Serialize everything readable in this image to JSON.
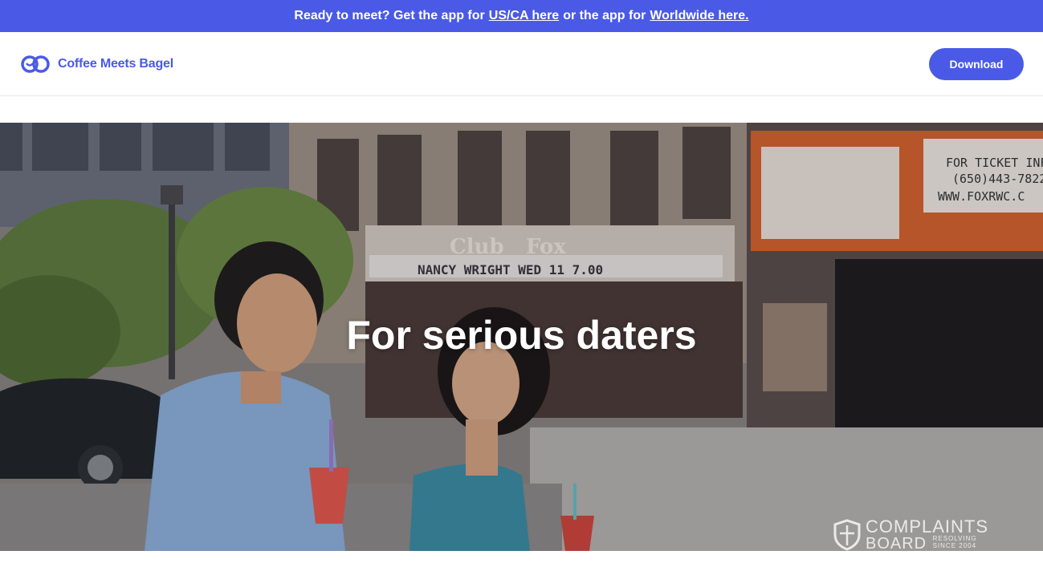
{
  "banner": {
    "prefix": "Ready to meet? Get the app for",
    "link_us_ca": "US/CA here",
    "middle": "or the app for",
    "link_worldwide": "Worldwide here."
  },
  "nav": {
    "brand": "Coffee Meets Bagel",
    "download_label": "Download"
  },
  "hero": {
    "title": "For serious daters",
    "sign_club": "Club",
    "sign_fox": "Fox",
    "sign_marquee": "NANCY WRIGHT WED 11 7.00",
    "sign_ticket_1": "FOR TICKET INF",
    "sign_ticket_2": "(650)443-7822",
    "sign_ticket_3": "WWW.FOXRWC.C"
  },
  "watermark": {
    "line1": "COMPLAINTS",
    "line2": "BOARD",
    "tag1": "RESOLVING",
    "tag2": "SINCE 2004"
  },
  "colors": {
    "brand": "#4a5ae6",
    "white": "#ffffff"
  },
  "icons": {
    "logo": "coffee-meets-bagel-logo-icon",
    "watermark": "shield-icon"
  }
}
